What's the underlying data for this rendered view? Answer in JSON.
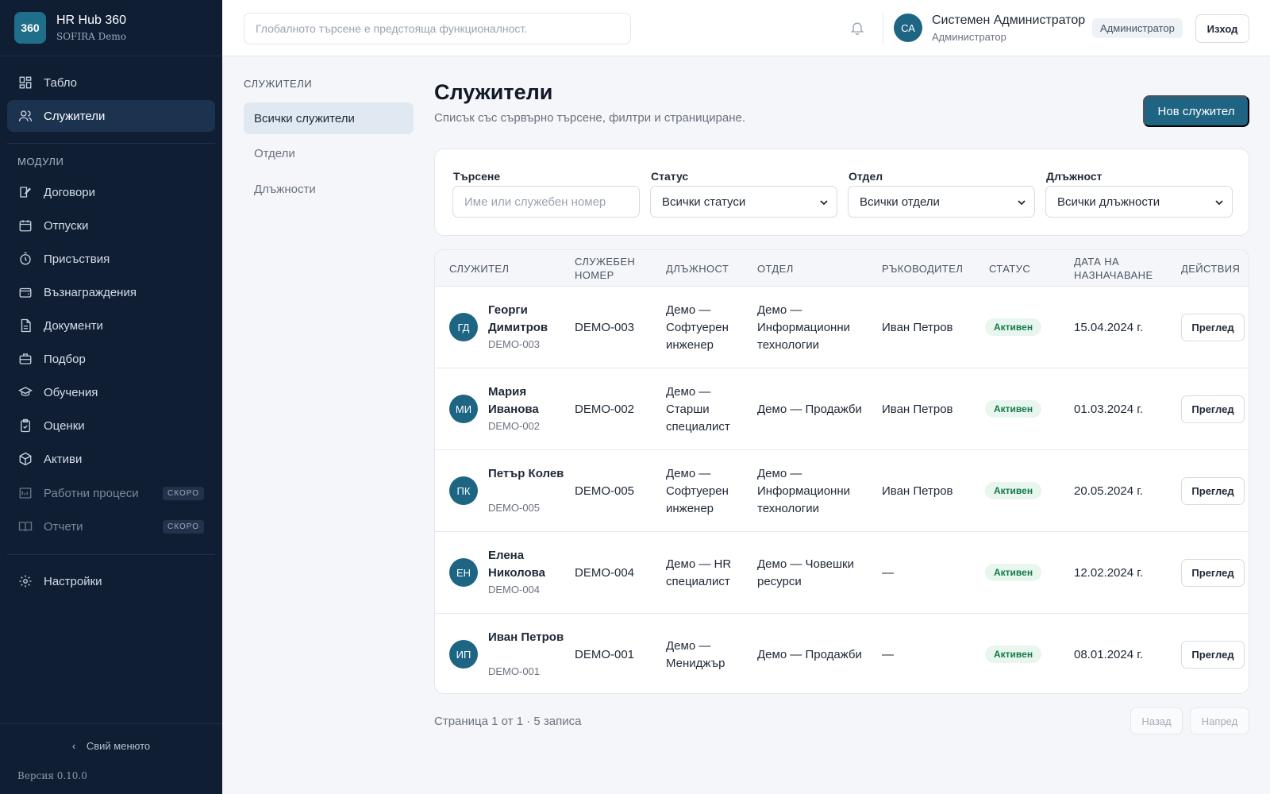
{
  "brand": {
    "logo": "360",
    "title": "HR Hub 360",
    "subtitle": "SOFIRA Demo"
  },
  "sidebar": {
    "primary": [
      {
        "label": "Табло",
        "icon": "dashboard-icon"
      },
      {
        "label": "Служители",
        "icon": "users-icon",
        "active": true
      }
    ],
    "modules_label": "МОДУЛИ",
    "modules": [
      {
        "label": "Договори",
        "icon": "contract-icon"
      },
      {
        "label": "Отпуски",
        "icon": "calendar-icon"
      },
      {
        "label": "Присъствия",
        "icon": "timer-icon"
      },
      {
        "label": "Възнаграждения",
        "icon": "wallet-icon"
      },
      {
        "label": "Документи",
        "icon": "document-icon"
      },
      {
        "label": "Подбор",
        "icon": "briefcase-icon"
      },
      {
        "label": "Обучения",
        "icon": "graduation-cap-icon"
      },
      {
        "label": "Оценки",
        "icon": "clipboard-icon"
      },
      {
        "label": "Активи",
        "icon": "box-icon"
      },
      {
        "label": "Работни процеси",
        "icon": "workflow-icon",
        "badge": "СКОРО",
        "disabled": true
      },
      {
        "label": "Отчети",
        "icon": "book-icon",
        "badge": "СКОРО",
        "disabled": true
      }
    ],
    "settings": {
      "label": "Настройки",
      "icon": "gear-icon"
    },
    "collapse_label": "Свий менюто",
    "version": "Версия 0.10.0"
  },
  "header": {
    "search_placeholder": "Глобалното търсене е предстояща функционалност.",
    "user": {
      "initials": "СА",
      "name": "Системен Администратор",
      "role": "Администратор"
    },
    "role_badge": "Администратор",
    "logout_label": "Изход"
  },
  "subnav": {
    "title": "СЛУЖИТЕЛИ",
    "items": [
      {
        "label": "Всички служители",
        "active": true
      },
      {
        "label": "Отдели"
      },
      {
        "label": "Длъжности"
      }
    ]
  },
  "page": {
    "title": "Служители",
    "subtitle": "Списък със сървърно търсене, филтри и странициране.",
    "new_button": "Нов служител"
  },
  "filters": {
    "search": {
      "label": "Търсене",
      "placeholder": "Име или служебен номер"
    },
    "status": {
      "label": "Статус",
      "value": "Всички статуси"
    },
    "department": {
      "label": "Отдел",
      "value": "Всички отдели"
    },
    "position": {
      "label": "Длъжност",
      "value": "Всички длъжности"
    }
  },
  "table": {
    "columns": [
      "СЛУЖИТЕЛ",
      "СЛУЖЕБЕН НОМЕР",
      "ДЛЪЖНОСТ",
      "ОТДЕЛ",
      "РЪКОВОДИТЕЛ",
      "СТАТУС",
      "ДАТА НА НАЗНАЧАВАНЕ",
      "ДЕЙСТВИЯ"
    ],
    "rows": [
      {
        "initials": "ГД",
        "name": "Георги Димитров",
        "code": "DEMO-003",
        "number": "DEMO-003",
        "position": "Демо — Софтуерен инженер",
        "department": "Демо — Информационни технологии",
        "manager": "Иван Петров",
        "status": "Активен",
        "hired": "15.04.2024 г.",
        "action": "Преглед"
      },
      {
        "initials": "МИ",
        "name": "Мария Иванова",
        "code": "DEMO-002",
        "number": "DEMO-002",
        "position": "Демо — Старши специалист",
        "department": "Демо — Продажби",
        "manager": "Иван Петров",
        "status": "Активен",
        "hired": "01.03.2024 г.",
        "action": "Преглед"
      },
      {
        "initials": "ПК",
        "name": "Петър Колев",
        "code": "DEMO-005",
        "number": "DEMO-005",
        "position": "Демо — Софтуерен инженер",
        "department": "Демо — Информационни технологии",
        "manager": "Иван Петров",
        "status": "Активен",
        "hired": "20.05.2024 г.",
        "action": "Преглед"
      },
      {
        "initials": "ЕН",
        "name": "Елена Николова",
        "code": "DEMO-004",
        "number": "DEMO-004",
        "position": "Демо — HR специалист",
        "department": "Демо — Човешки ресурси",
        "manager": "—",
        "status": "Активен",
        "hired": "12.02.2024 г.",
        "action": "Преглед"
      },
      {
        "initials": "ИП",
        "name": "Иван Петров",
        "code": "DEMO-001",
        "number": "DEMO-001",
        "position": "Демо — Мениджър",
        "department": "Демо — Продажби",
        "manager": "—",
        "status": "Активен",
        "hired": "08.01.2024 г.",
        "action": "Преглед"
      }
    ]
  },
  "pagination": {
    "summary": "Страница 1 от 1 · 5 записа",
    "prev": "Назад",
    "next": "Напред"
  },
  "colors": {
    "sidebar_bg": "#0f1e33",
    "accent": "#1f6583",
    "status_active": "#157a4a"
  }
}
